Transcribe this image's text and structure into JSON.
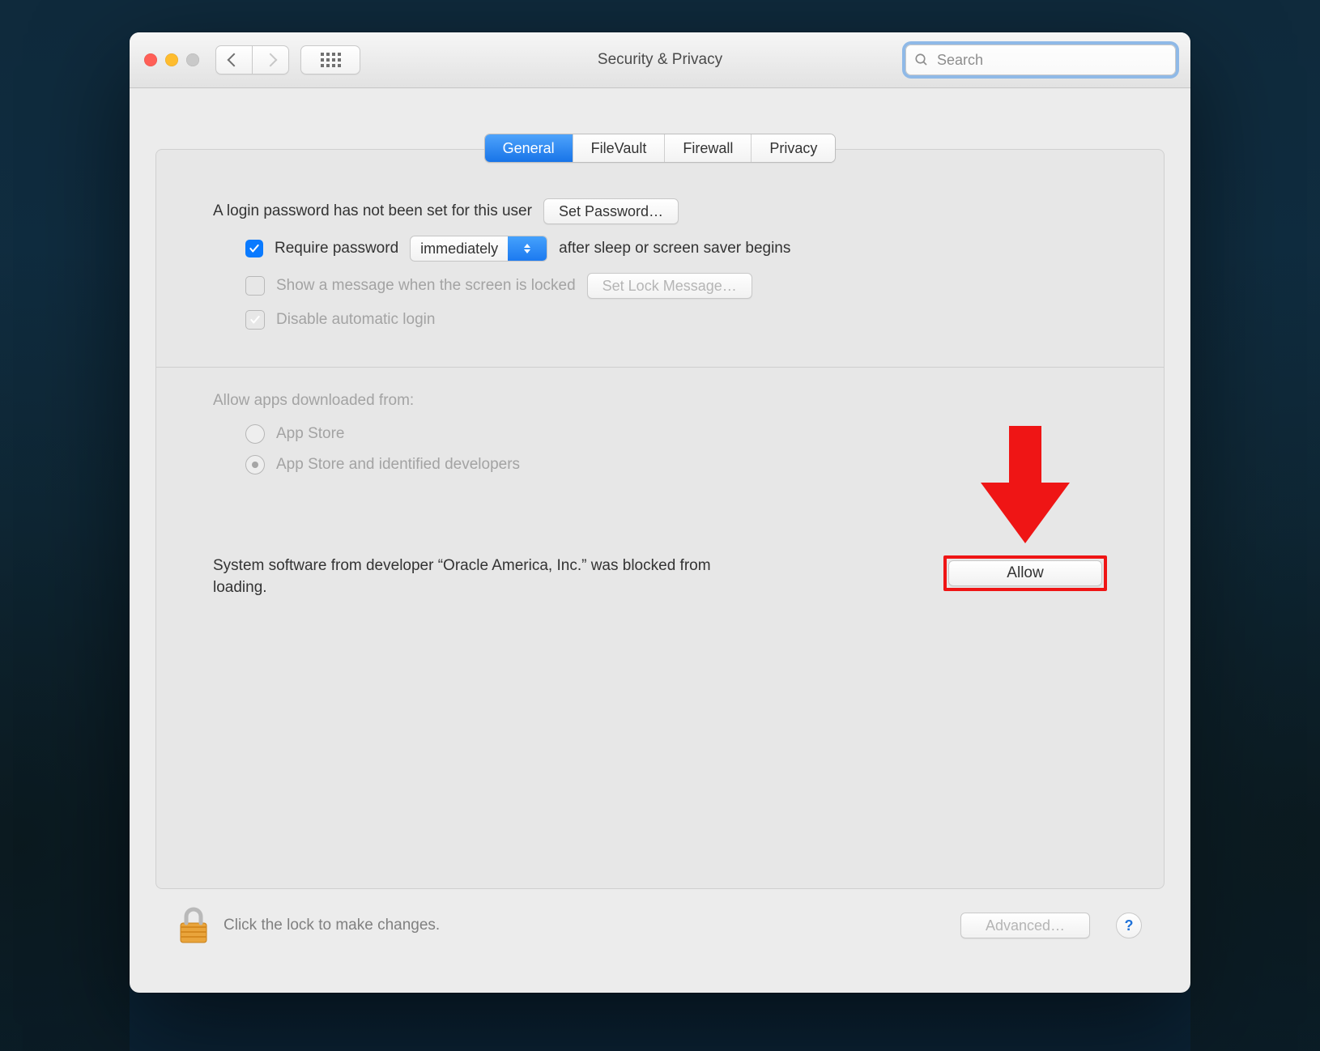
{
  "window": {
    "title": "Security & Privacy"
  },
  "search": {
    "placeholder": "Search",
    "value": ""
  },
  "tabs": [
    {
      "label": "General",
      "active": true
    },
    {
      "label": "FileVault",
      "active": false
    },
    {
      "label": "Firewall",
      "active": false
    },
    {
      "label": "Privacy",
      "active": false
    }
  ],
  "general": {
    "password_unset_msg": "A login password has not been set for this user",
    "set_password_btn": "Set Password…",
    "require_password_label": "Require password",
    "require_password_delay": "immediately",
    "require_password_suffix": "after sleep or screen saver begins",
    "show_message_label": "Show a message when the screen is locked",
    "set_lock_message_btn": "Set Lock Message…",
    "disable_auto_login_label": "Disable automatic login",
    "allow_apps_header": "Allow apps downloaded from:",
    "allow_apps_option_store": "App Store",
    "allow_apps_option_identified": "App Store and identified developers",
    "blocked_message": "System software from developer “Oracle America, Inc.” was blocked from loading.",
    "allow_btn": "Allow"
  },
  "footer": {
    "lock_hint": "Click the lock to make changes.",
    "advanced_btn": "Advanced…",
    "help_label": "?"
  }
}
